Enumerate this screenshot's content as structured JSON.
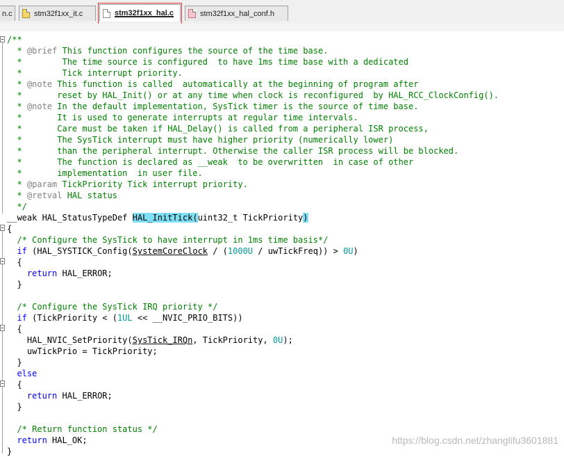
{
  "tabs": [
    {
      "label": "n.c",
      "icon": "none"
    },
    {
      "label": "stm32f1xx_it.c",
      "icon": "yellow"
    },
    {
      "label": "stm32f1xx_hal.c",
      "icon": "white",
      "active": true
    },
    {
      "label": "stm32f1xx_hal_conf.h",
      "icon": "pink"
    }
  ],
  "code": {
    "l1": "/**",
    "l2a": "  * ",
    "l2tag": "@brief",
    "l2b": " This function configures the source of the time base.",
    "l3": "  *        The time source is configured  to have 1ms time base with a dedicated",
    "l4": "  *        Tick interrupt priority.",
    "l5a": "  * ",
    "l5tag": "@note",
    "l5b": " This function is called  automatically at the beginning of program after",
    "l6": "  *       reset by HAL_Init() or at any time when clock is reconfigured  by HAL_RCC_ClockConfig().",
    "l7a": "  * ",
    "l7tag": "@note",
    "l7b": " In the default implementation, SysTick timer is the source of time base.",
    "l8": "  *       It is used to generate interrupts at regular time intervals.",
    "l9": "  *       Care must be taken if HAL_Delay() is called from a peripheral ISR process,",
    "l10": "  *       The SysTick interrupt must have higher priority (numerically lower)",
    "l11": "  *       than the peripheral interrupt. Otherwise the caller ISR process will be blocked.",
    "l12": "  *       The function is declared as __weak  to be overwritten  in case of other",
    "l13": "  *       implementation  in user file.",
    "l14a": "  * ",
    "l14tag": "@param",
    "l14b": " TickPriority Tick interrupt priority.",
    "l15a": "  * ",
    "l15tag": "@retval",
    "l15b": " HAL status",
    "l16": "  */",
    "l17a": "__weak HAL_StatusTypeDef ",
    "l17fn": "HAL_InitTick",
    "l17p1": "(",
    "l17b": "uint32_t TickPriority",
    "l17p2": ")",
    "l18": "{",
    "l19": "  /* Configure the SysTick to have interrupt in 1ms time basis*/",
    "l20kw": "if",
    "l20a": " (HAL_SYSTICK_Config(",
    "l20u": "SystemCoreClock",
    "l20b": " / (",
    "l20n1": "1000U",
    "l20c": " / uwTickFreq)) > ",
    "l20n2": "0U",
    "l20d": ")",
    "l21": "  {",
    "l22kw": "return",
    "l22b": " HAL_ERROR;",
    "l23": "  }",
    "l24": "",
    "l25": "  /* Configure the SysTick IRQ priority */",
    "l26kw": "if",
    "l26a": " (TickPriority < (",
    "l26n": "1UL",
    "l26b": " << __NVIC_PRIO_BITS))",
    "l27": "  {",
    "l28a": "    HAL_NVIC_SetPriority(",
    "l28u": "SysTick_IRQn",
    "l28b": ", TickPriority, ",
    "l28n": "0U",
    "l28c": ");",
    "l29": "    uwTickPrio = TickPriority;",
    "l30": "  }",
    "l31kw": "else",
    "l32": "  {",
    "l33kw": "return",
    "l33b": " HAL_ERROR;",
    "l34": "  }",
    "l35": "",
    "l36": "  /* Return function status */",
    "l37kw": "return",
    "l37b": " HAL_OK;",
    "l38": "}"
  },
  "watermark": "https://blog.csdn.net/zhanglifu3601881"
}
